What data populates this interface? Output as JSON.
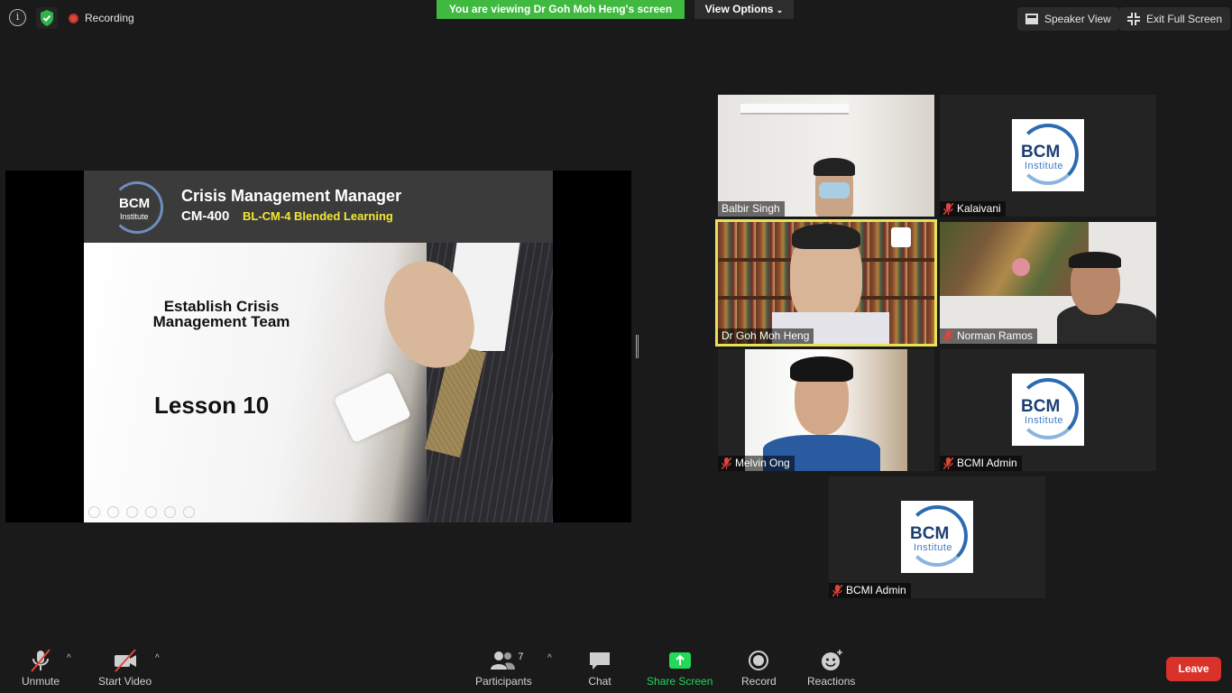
{
  "top_bar": {
    "recording_label": "Recording",
    "viewing_banner": "You are viewing Dr Goh Moh Heng's screen",
    "view_options_label": "View Options",
    "speaker_view_label": "Speaker View",
    "exit_fullscreen_label": "Exit Full Screen"
  },
  "shared_slide": {
    "logo_text": "BCM",
    "logo_subtext": "Institute",
    "title": "Crisis Management Manager",
    "course_code": "CM-400",
    "subtitle": "BL-CM-4 Blended Learning",
    "heading_line1": "Establish Crisis",
    "heading_line2": "Management Team",
    "lesson": "Lesson 10"
  },
  "participants": [
    {
      "name": "Balbir Singh",
      "muted": false,
      "video": "camera"
    },
    {
      "name": "Kalaivani",
      "muted": true,
      "video": "bcm-logo"
    },
    {
      "name": "Dr Goh Moh Heng",
      "muted": false,
      "video": "camera",
      "active_speaker": true
    },
    {
      "name": "Norman Ramos",
      "muted": true,
      "video": "camera"
    },
    {
      "name": "Melvin Ong",
      "muted": true,
      "video": "camera"
    },
    {
      "name": "BCMI Admin",
      "muted": true,
      "video": "bcm-logo"
    },
    {
      "name": "BCMI Admin",
      "muted": true,
      "video": "bcm-logo"
    }
  ],
  "bcm_logo": {
    "text": "BCM",
    "subtext": "Institute"
  },
  "toolbar": {
    "unmute_label": "Unmute",
    "start_video_label": "Start Video",
    "participants_label": "Participants",
    "participants_count": "7",
    "chat_label": "Chat",
    "share_screen_label": "Share Screen",
    "record_label": "Record",
    "reactions_label": "Reactions",
    "leave_label": "Leave"
  },
  "colors": {
    "banner_green": "#3fb93f",
    "share_green": "#23d959",
    "leave_red": "#d8322b",
    "active_speaker_border": "#e8e15a",
    "muted_red": "#e0443c"
  }
}
